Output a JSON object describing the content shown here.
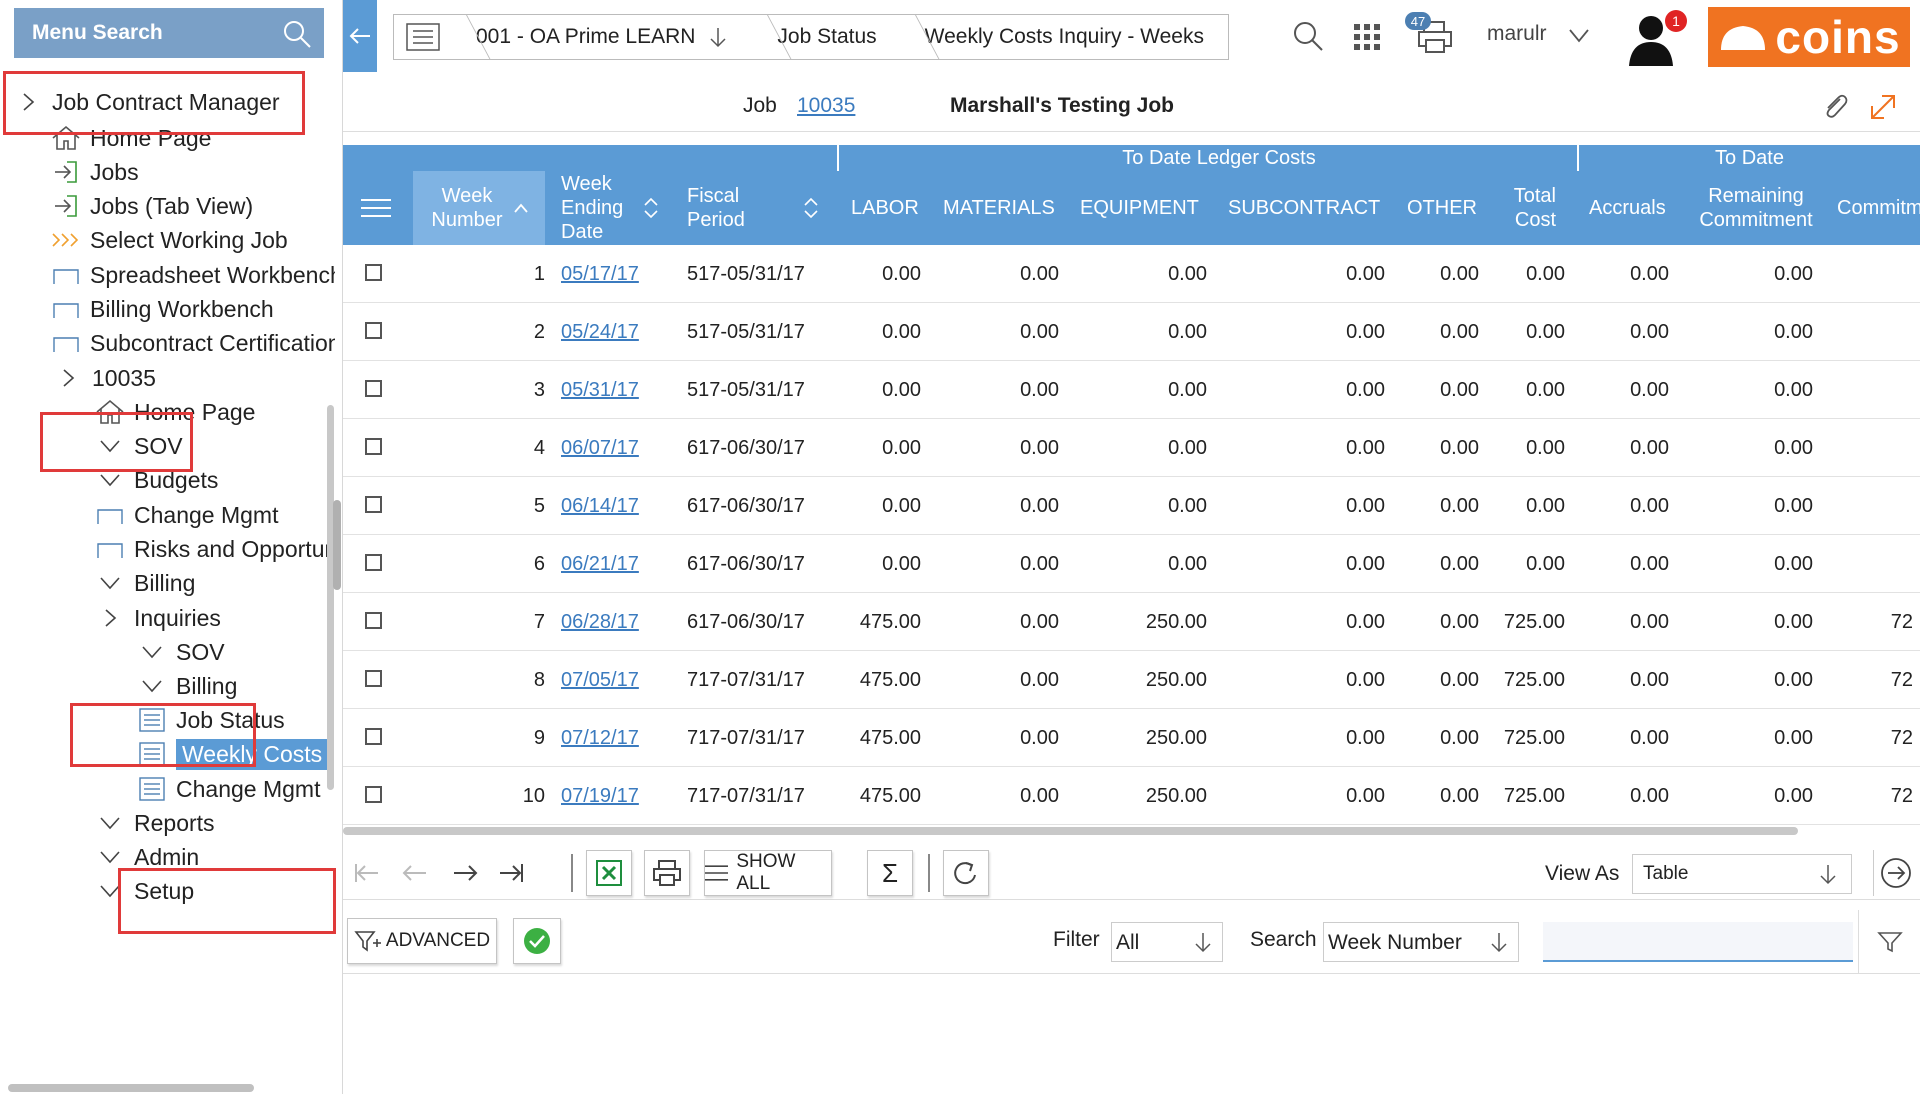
{
  "sidebar": {
    "menu_search_label": "Menu Search",
    "items": [
      {
        "label": "Job Contract Manager",
        "icon": "chevron-right-icon"
      },
      {
        "label": "Home Page",
        "icon": "home-icon"
      },
      {
        "label": "Jobs",
        "icon": "enter-icon"
      },
      {
        "label": "Jobs (Tab View)",
        "icon": "enter-icon"
      },
      {
        "label": "Select Working Job",
        "icon": "triple-chevron-icon"
      },
      {
        "label": "Spreadsheet Workbench",
        "icon": "folder-icon"
      },
      {
        "label": "Billing Workbench",
        "icon": "folder-icon"
      },
      {
        "label": "Subcontract Certification",
        "icon": "folder-icon"
      },
      {
        "label": "10035",
        "icon": "chevron-right-icon"
      },
      {
        "label": "Home Page",
        "icon": "home-icon"
      },
      {
        "label": "SOV",
        "icon": "chevron-down-icon"
      },
      {
        "label": "Budgets",
        "icon": "chevron-down-icon"
      },
      {
        "label": "Change Mgmt",
        "icon": "folder-icon"
      },
      {
        "label": "Risks and Opportunities",
        "icon": "folder-icon"
      },
      {
        "label": "Billing",
        "icon": "chevron-down-icon"
      },
      {
        "label": "Inquiries",
        "icon": "chevron-right-icon"
      },
      {
        "label": "SOV",
        "icon": "chevron-down-icon"
      },
      {
        "label": "Billing",
        "icon": "chevron-down-icon"
      },
      {
        "label": "Job Status",
        "icon": "list-icon"
      },
      {
        "label": "Weekly Costs",
        "icon": "list-icon"
      },
      {
        "label": "Change Mgmt",
        "icon": "list-icon"
      },
      {
        "label": "Reports",
        "icon": "chevron-down-icon"
      },
      {
        "label": "Admin",
        "icon": "chevron-down-icon"
      },
      {
        "label": "Setup",
        "icon": "chevron-down-icon"
      }
    ]
  },
  "breadcrumb": {
    "company": "001 - OA Prime LEARN",
    "section": "Job Status",
    "page": "Weekly Costs Inquiry - Weeks"
  },
  "topbar": {
    "print_badge": "47",
    "user_name": "marulr",
    "avatar_badge": "1",
    "logo_text": "coins",
    "brand_color": "#f07321",
    "accent_color": "#5b9bd5"
  },
  "job": {
    "label": "Job",
    "number": "10035",
    "name": "Marshall's Testing Job"
  },
  "grid": {
    "group_headers": [
      "To Date Ledger Costs",
      "To Date"
    ],
    "columns": [
      {
        "key": "week",
        "label": "Week Number"
      },
      {
        "key": "date",
        "label": "Week Ending Date"
      },
      {
        "key": "fiscal",
        "label": "Fiscal Period"
      },
      {
        "key": "labor",
        "label": "LABOR"
      },
      {
        "key": "materials",
        "label": "MATERIALS"
      },
      {
        "key": "equipment",
        "label": "EQUIPMENT"
      },
      {
        "key": "subcontract",
        "label": "SUBCONTRACT"
      },
      {
        "key": "other",
        "label": "OTHER"
      },
      {
        "key": "total",
        "label": "Total Cost"
      },
      {
        "key": "accruals",
        "label": "Accruals"
      },
      {
        "key": "remaining",
        "label": "Remaining Commitment"
      },
      {
        "key": "commit",
        "label": "Commitm"
      }
    ],
    "rows": [
      {
        "week": "1",
        "date": "05/17/17",
        "fiscal": "517-05/31/17",
        "labor": "0.00",
        "materials": "0.00",
        "equipment": "0.00",
        "subcontract": "0.00",
        "other": "0.00",
        "total": "0.00",
        "accruals": "0.00",
        "remaining": "0.00",
        "commit": ""
      },
      {
        "week": "2",
        "date": "05/24/17",
        "fiscal": "517-05/31/17",
        "labor": "0.00",
        "materials": "0.00",
        "equipment": "0.00",
        "subcontract": "0.00",
        "other": "0.00",
        "total": "0.00",
        "accruals": "0.00",
        "remaining": "0.00",
        "commit": ""
      },
      {
        "week": "3",
        "date": "05/31/17",
        "fiscal": "517-05/31/17",
        "labor": "0.00",
        "materials": "0.00",
        "equipment": "0.00",
        "subcontract": "0.00",
        "other": "0.00",
        "total": "0.00",
        "accruals": "0.00",
        "remaining": "0.00",
        "commit": ""
      },
      {
        "week": "4",
        "date": "06/07/17",
        "fiscal": "617-06/30/17",
        "labor": "0.00",
        "materials": "0.00",
        "equipment": "0.00",
        "subcontract": "0.00",
        "other": "0.00",
        "total": "0.00",
        "accruals": "0.00",
        "remaining": "0.00",
        "commit": ""
      },
      {
        "week": "5",
        "date": "06/14/17",
        "fiscal": "617-06/30/17",
        "labor": "0.00",
        "materials": "0.00",
        "equipment": "0.00",
        "subcontract": "0.00",
        "other": "0.00",
        "total": "0.00",
        "accruals": "0.00",
        "remaining": "0.00",
        "commit": ""
      },
      {
        "week": "6",
        "date": "06/21/17",
        "fiscal": "617-06/30/17",
        "labor": "0.00",
        "materials": "0.00",
        "equipment": "0.00",
        "subcontract": "0.00",
        "other": "0.00",
        "total": "0.00",
        "accruals": "0.00",
        "remaining": "0.00",
        "commit": ""
      },
      {
        "week": "7",
        "date": "06/28/17",
        "fiscal": "617-06/30/17",
        "labor": "475.00",
        "materials": "0.00",
        "equipment": "250.00",
        "subcontract": "0.00",
        "other": "0.00",
        "total": "725.00",
        "accruals": "0.00",
        "remaining": "0.00",
        "commit": "72"
      },
      {
        "week": "8",
        "date": "07/05/17",
        "fiscal": "717-07/31/17",
        "labor": "475.00",
        "materials": "0.00",
        "equipment": "250.00",
        "subcontract": "0.00",
        "other": "0.00",
        "total": "725.00",
        "accruals": "0.00",
        "remaining": "0.00",
        "commit": "72"
      },
      {
        "week": "9",
        "date": "07/12/17",
        "fiscal": "717-07/31/17",
        "labor": "475.00",
        "materials": "0.00",
        "equipment": "250.00",
        "subcontract": "0.00",
        "other": "0.00",
        "total": "725.00",
        "accruals": "0.00",
        "remaining": "0.00",
        "commit": "72"
      },
      {
        "week": "10",
        "date": "07/19/17",
        "fiscal": "717-07/31/17",
        "labor": "475.00",
        "materials": "0.00",
        "equipment": "250.00",
        "subcontract": "0.00",
        "other": "0.00",
        "total": "725.00",
        "accruals": "0.00",
        "remaining": "0.00",
        "commit": "72"
      }
    ]
  },
  "toolbar": {
    "show_all_label": "SHOW ALL",
    "view_as_label": "View As",
    "view_as_value": "Table"
  },
  "filterbar": {
    "advanced_label": "ADVANCED",
    "filter_label": "Filter",
    "filter_value": "All",
    "search_label": "Search",
    "search_field_value": "Week Number",
    "search_input_value": ""
  }
}
